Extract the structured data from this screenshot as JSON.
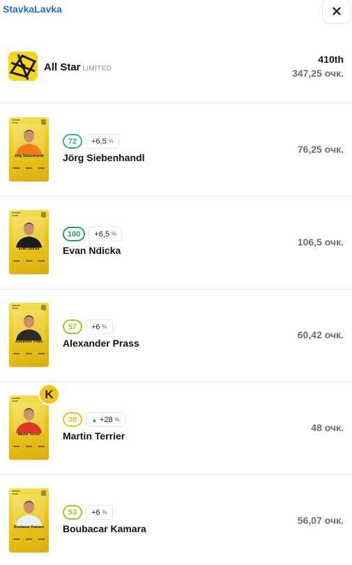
{
  "app": {
    "brand": "StavkaLavka",
    "close_icon": "close-icon"
  },
  "league": {
    "name": "All Star",
    "tag": "LIMITED",
    "rank": "410th",
    "total": "347,25 очк.",
    "logo_icon": "league-logo-icon"
  },
  "players": [
    {
      "name": "Jörg Siebenhandl",
      "card_name": "Jörg Siebenhandl",
      "score": "72",
      "score_color": "#27b3a0",
      "bonus": "+6,5",
      "bonus_up": false,
      "points": "76,25 очк.",
      "kit": "#f07a1e"
    },
    {
      "name": "Evan Ndicka",
      "card_name": "Evan Ndicka",
      "score": "100",
      "score_color": "#1fa05a",
      "bonus": "+6,5",
      "bonus_up": false,
      "points": "106,5 очк.",
      "kit": "#1c1c1c"
    },
    {
      "name": "Alexander Prass",
      "card_name": "Alexander Prass",
      "score": "57",
      "score_color": "#a6c21e",
      "bonus": "+6",
      "bonus_up": false,
      "points": "60,42 очк.",
      "kit": "#2a2a2a"
    },
    {
      "name": "Martin Terrier",
      "card_name": "Martin Terrier",
      "score": "38",
      "score_color": "#e7c024",
      "bonus": "+28",
      "bonus_up": true,
      "points": "48 очк.",
      "kit": "#e0352f"
    },
    {
      "name": "Boubacar Kamara",
      "card_name": "Boubacar Kamara",
      "score": "53",
      "score_color": "#a6c21e",
      "bonus": "+6",
      "bonus_up": false,
      "points": "56,07 очк.",
      "kit": "#e9f1f8"
    }
  ],
  "captain_label": "K",
  "percent_sign": "%"
}
